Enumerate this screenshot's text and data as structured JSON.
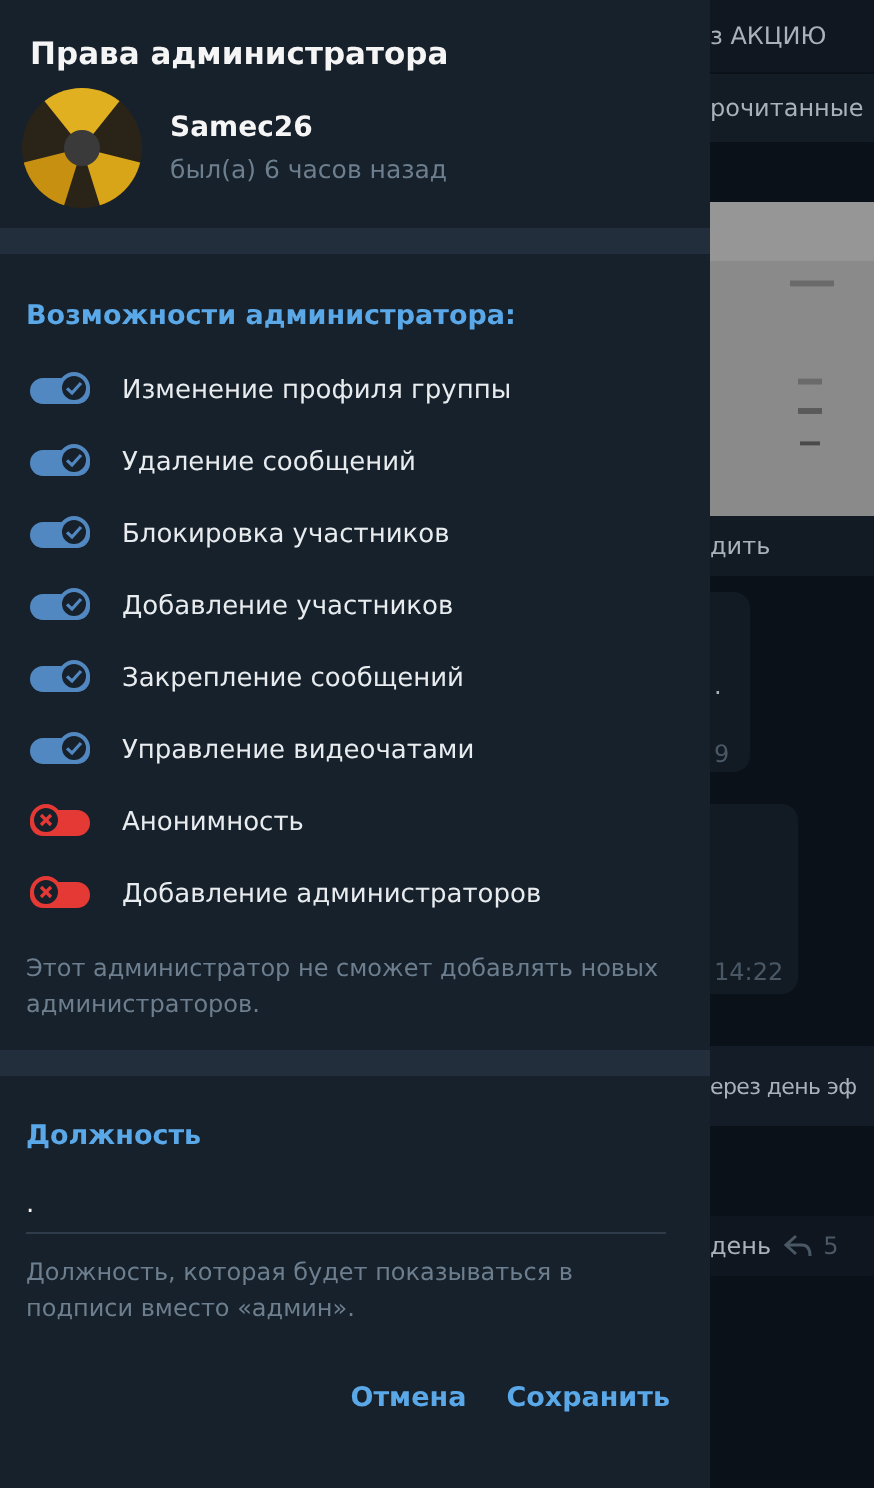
{
  "dialog": {
    "title": "Права администратора",
    "user": {
      "name": "Samec26",
      "status": "был(а) 6 часов назад"
    },
    "section_title": "Возможности администратора:",
    "permissions": [
      {
        "label": "Изменение профиля группы",
        "on": true
      },
      {
        "label": "Удаление сообщений",
        "on": true
      },
      {
        "label": "Блокировка участников",
        "on": true
      },
      {
        "label": "Добавление участников",
        "on": true
      },
      {
        "label": "Закрепление сообщений",
        "on": true
      },
      {
        "label": "Управление видеочатами",
        "on": true
      },
      {
        "label": "Анонимность",
        "on": false
      },
      {
        "label": "Добавление администраторов",
        "on": false
      }
    ],
    "permissions_note": "Этот администратор не сможет добавлять новых администраторов.",
    "rank": {
      "title": "Должность",
      "value": ".",
      "hint": "Должность, которая будет показываться в подписи вместо «админ»."
    },
    "buttons": [
      "Отмена",
      "Сохранить"
    ]
  },
  "background_chat": {
    "pinned": "з АКЦИЮ",
    "unread": "рочитанные",
    "caption": "дить",
    "bubble_1": ".",
    "bubble_1_time": "9",
    "bubble_2_time": "14:22",
    "message": "ерез день эф",
    "reply": "день",
    "reply_count": "5"
  }
}
